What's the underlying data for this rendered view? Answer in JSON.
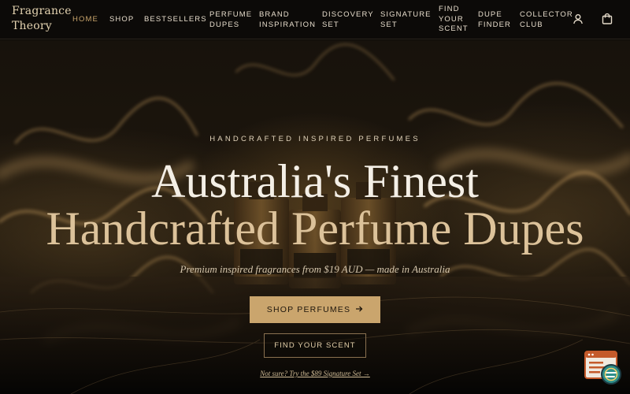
{
  "brand": {
    "line1": "Fragrance",
    "line2": "Theory"
  },
  "nav": [
    {
      "id": "home",
      "lines": [
        "HOME"
      ],
      "active": true
    },
    {
      "id": "shop",
      "lines": [
        "SHOP"
      ]
    },
    {
      "id": "bestsellers",
      "lines": [
        "BESTSELLERS"
      ]
    },
    {
      "id": "perfume-dupes",
      "lines": [
        "PERFUME",
        "DUPES"
      ]
    },
    {
      "id": "brand-inspiration",
      "lines": [
        "BRAND",
        "INSPIRATION"
      ]
    },
    {
      "id": "discovery-set",
      "lines": [
        "DISCOVERY",
        "SET"
      ]
    },
    {
      "id": "signature-set",
      "lines": [
        "SIGNATURE",
        "SET"
      ]
    },
    {
      "id": "find-your-scent",
      "lines": [
        "FIND",
        "YOUR",
        "SCENT"
      ]
    },
    {
      "id": "dupe-finder",
      "lines": [
        "DUPE",
        "FINDER"
      ]
    },
    {
      "id": "collector-club",
      "lines": [
        "COLLECTOR",
        "CLUB"
      ]
    }
  ],
  "header_icons": {
    "account": "user-icon",
    "cart": "shopping-bag-icon"
  },
  "hero": {
    "eyebrow": "HANDCRAFTED INSPIRED PERFUMES",
    "headline_line1": "Australia's Finest",
    "headline_line2": "Handcrafted Perfume Dupes",
    "subline": "Premium inspired fragrances from $19 AUD — made in Australia",
    "primary_cta": "SHOP PERFUMES",
    "primary_cta_icon": "arrow-right-icon",
    "secondary_cta": "FIND YOUR SCENT",
    "signature_link": "Not sure? Try the $89 Signature Set →"
  },
  "chat_widget": {
    "icon": "chat-support-icon"
  },
  "colors": {
    "accent_gold": "#caa56d",
    "headline_gold": "#dcc29a",
    "headline_white": "#f4efe6",
    "background": "#0b0907"
  }
}
